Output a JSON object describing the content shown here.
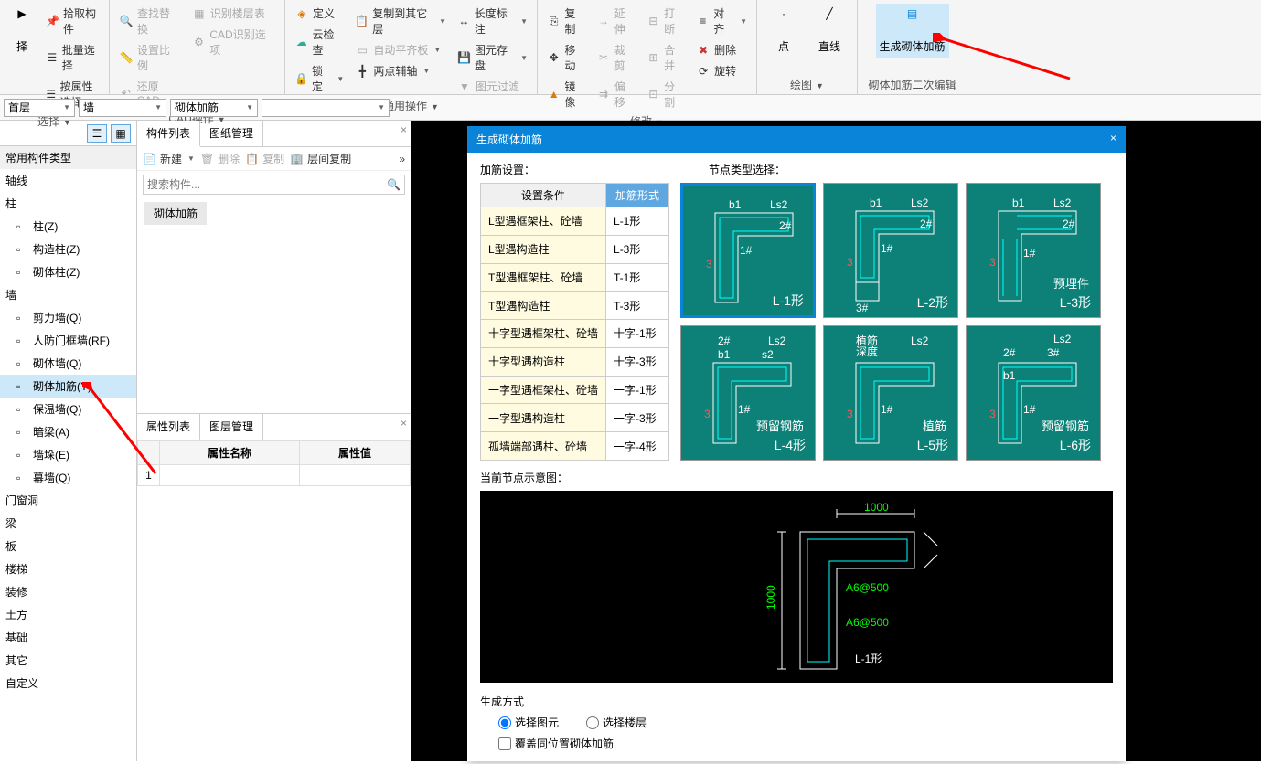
{
  "ribbon": {
    "groups": {
      "select": {
        "label": "选择",
        "items": [
          "拾取构件",
          "批量选择",
          "按属性选择"
        ]
      },
      "cad": {
        "label": "CAD操作",
        "items": [
          "查找替换",
          "设置比例",
          "还原CAD",
          "识别楼层表",
          "CAD识别选项"
        ]
      },
      "common": {
        "label": "通用操作",
        "items": [
          "定义",
          "云检查",
          "锁定",
          "复制到其它层",
          "自动平齐板",
          "两点辅轴",
          "长度标注",
          "图元存盘",
          "图元过滤"
        ]
      },
      "modify": {
        "label": "修改",
        "items": [
          "复制",
          "移动",
          "镜像",
          "延伸",
          "裁剪",
          "偏移",
          "打断",
          "合并",
          "分割",
          "对齐",
          "删除",
          "旋转"
        ]
      },
      "draw": {
        "label": "绘图",
        "items": [
          "点",
          "直线"
        ]
      },
      "gen": {
        "label": "砌体加筋二次编辑",
        "big": "生成砌体加筋"
      }
    }
  },
  "secondbar": {
    "floor": "首层",
    "category": "墙",
    "component": "砌体加筋"
  },
  "leftPanel": {
    "header": "常用构件类型",
    "groups": [
      {
        "label": "轴线",
        "children": []
      },
      {
        "label": "柱",
        "children": [
          "柱(Z)",
          "构造柱(Z)",
          "砌体柱(Z)"
        ]
      },
      {
        "label": "墙",
        "children": [
          "剪力墙(Q)",
          "人防门框墙(RF)",
          "砌体墙(Q)",
          "砌体加筋(Y)",
          "保温墙(Q)",
          "暗梁(A)",
          "墙垛(E)",
          "幕墙(Q)"
        ],
        "selected": "砌体加筋(Y)"
      },
      {
        "label": "门窗洞",
        "children": []
      },
      {
        "label": "梁",
        "children": []
      },
      {
        "label": "板",
        "children": []
      },
      {
        "label": "楼梯",
        "children": []
      },
      {
        "label": "装修",
        "children": []
      },
      {
        "label": "土方",
        "children": []
      },
      {
        "label": "基础",
        "children": []
      },
      {
        "label": "其它",
        "children": []
      },
      {
        "label": "自定义",
        "children": []
      }
    ]
  },
  "midPanel": {
    "tabs": [
      "构件列表",
      "图纸管理"
    ],
    "toolbar": {
      "new": "新建",
      "delete": "删除",
      "copy": "复制",
      "floorCopy": "层间复制"
    },
    "searchPlaceholder": "搜索构件...",
    "chip": "砌体加筋",
    "propTabs": [
      "属性列表",
      "图层管理"
    ],
    "propHeaders": [
      "属性名称",
      "属性值"
    ]
  },
  "dialog": {
    "title": "生成砌体加筋",
    "settingLabel": "加筋设置：",
    "nodeLabel": "节点类型选择：",
    "tableHeaders": [
      "设置条件",
      "加筋形式"
    ],
    "rows": [
      [
        "L型遇框架柱、砼墙",
        "L-1形"
      ],
      [
        "L型遇构造柱",
        "L-3形"
      ],
      [
        "T型遇框架柱、砼墙",
        "T-1形"
      ],
      [
        "T型遇构造柱",
        "T-3形"
      ],
      [
        "十字型遇框架柱、砼墙",
        "十字-1形"
      ],
      [
        "十字型遇构造柱",
        "十字-3形"
      ],
      [
        "一字型遇框架柱、砼墙",
        "一字-1形"
      ],
      [
        "一字型遇构造柱",
        "一字-3形"
      ],
      [
        "孤墙端部遇柱、砼墙",
        "一字-4形"
      ]
    ],
    "nodes": [
      {
        "label": "L-1形",
        "sub": ""
      },
      {
        "label": "L-2形",
        "sub": ""
      },
      {
        "label": "L-3形",
        "sub": "预埋件"
      },
      {
        "label": "L-4形",
        "sub": "预留钢筋"
      },
      {
        "label": "L-5形",
        "sub": "植筋"
      },
      {
        "label": "L-6形",
        "sub": "预留钢筋"
      }
    ],
    "diagramLabel": "当前节点示意图：",
    "diagram": {
      "dim1": "1000",
      "dim2": "1000",
      "rebar1": "A6@500",
      "rebar2": "A6@500",
      "type": "L-1形"
    },
    "genLabel": "生成方式",
    "radio1": "选择图元",
    "radio2": "选择楼层",
    "checkbox": "覆盖同位置砌体加筋"
  }
}
